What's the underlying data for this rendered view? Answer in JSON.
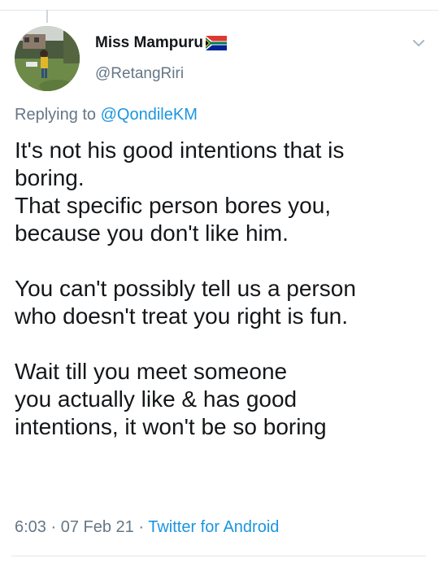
{
  "author": {
    "display_name": "Miss Mampuru",
    "handle": "@RetangRiri"
  },
  "reply": {
    "prefix": "Replying to ",
    "mention": "@QondileKM"
  },
  "tweet": {
    "lines": [
      "It's not his good intentions that is",
      "boring.",
      "That specific person bores you,",
      "because you don't like him.",
      "",
      "You can't possibly tell us a person",
      "who doesn't treat you right is fun.",
      "",
      "Wait till you meet someone",
      "you actually like & has good",
      "intentions, it won't be so boring"
    ]
  },
  "meta": {
    "time": "6:03",
    "separator": " · ",
    "date": "07 Feb 21",
    "source": "Twitter for Android"
  },
  "icons": {
    "flag": "south-africa-flag-icon",
    "menu": "chevron-down-icon"
  },
  "colors": {
    "link": "#1b95e0",
    "secondary_text": "#657786",
    "primary_text": "#14171a"
  }
}
